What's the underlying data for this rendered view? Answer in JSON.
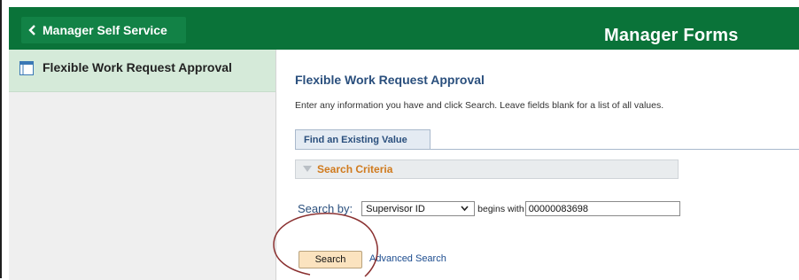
{
  "header": {
    "back_label": "Manager Self Service",
    "title": "Manager Forms",
    "color": "#0a7339"
  },
  "sidebar": {
    "items": [
      {
        "label": "Flexible Work Request Approval",
        "icon": "form-icon"
      }
    ]
  },
  "form": {
    "title": "Flexible Work Request Approval",
    "instructions": "Enter any information you have and click Search. Leave fields blank for a list of all values.",
    "tab_label": "Find an Existing Value",
    "criteria_label": "Search Criteria",
    "search_by_label": "Search by:",
    "field_select": "Supervisor ID",
    "operator_label": "begins with",
    "value": "00000083698",
    "search_button": "Search",
    "advanced_link": "Advanced Search"
  },
  "annotation": {
    "shape": "ellipse",
    "color": "#8a3030",
    "target": "search-button"
  }
}
